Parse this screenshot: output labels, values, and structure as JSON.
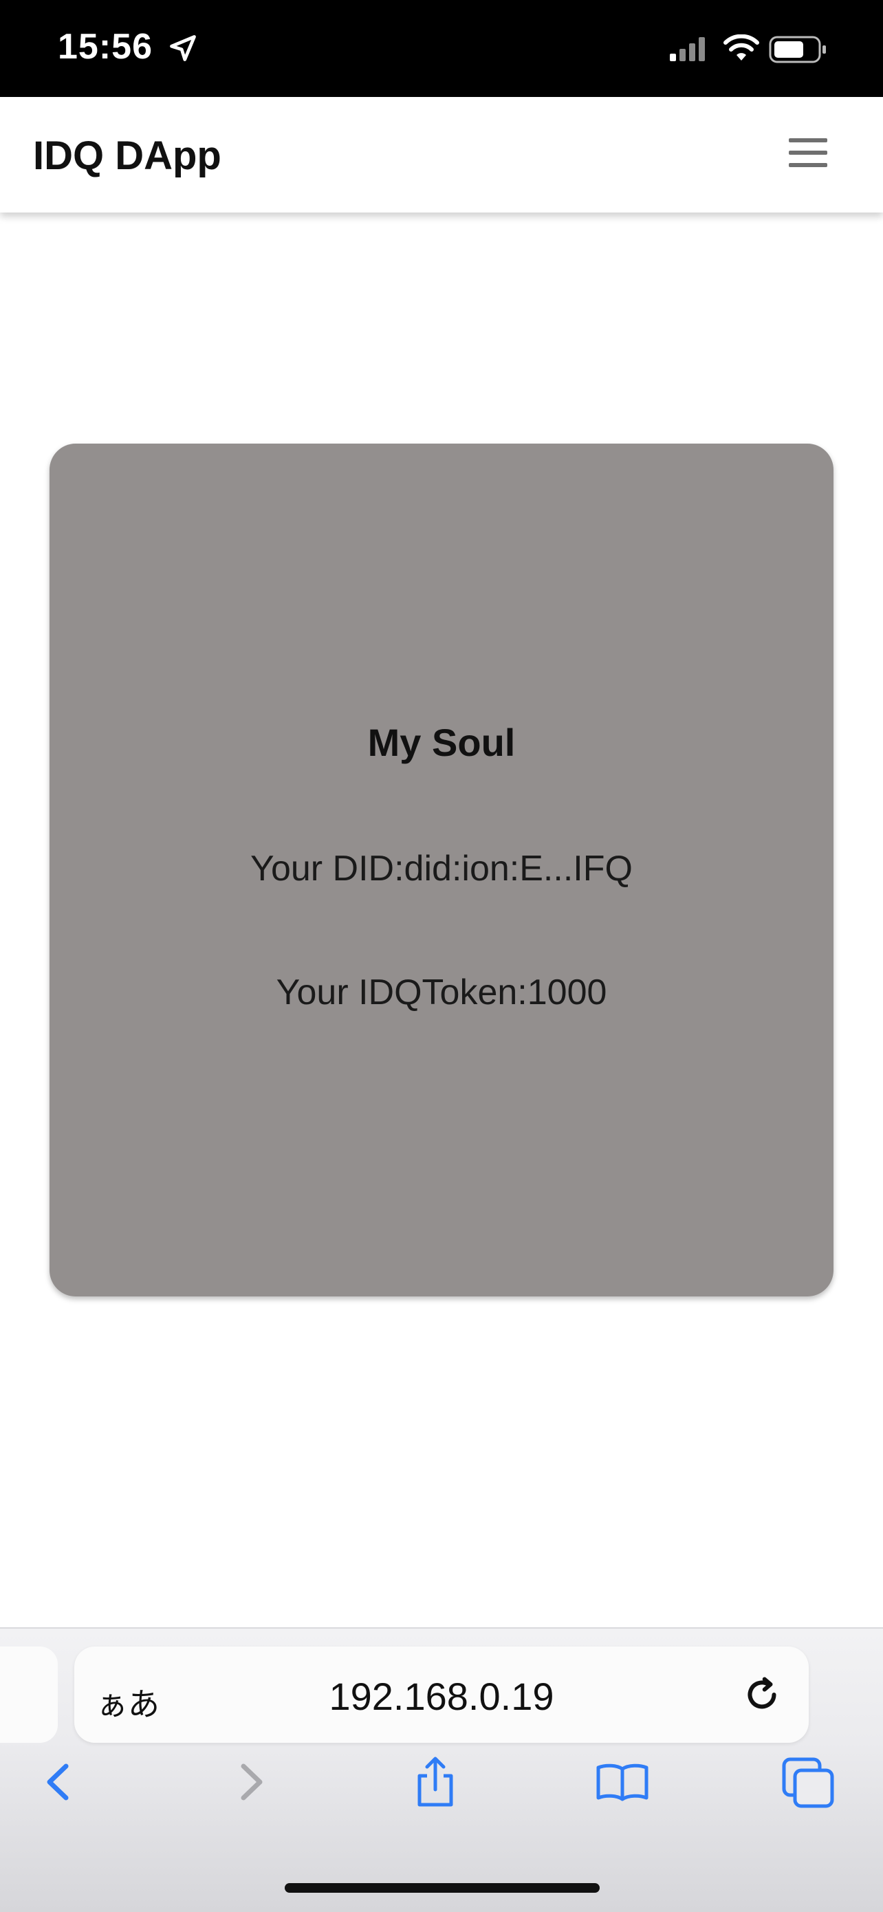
{
  "status_bar": {
    "time": "15:56",
    "icons": [
      "location-arrow-icon",
      "cellular-signal-icon",
      "wifi-icon",
      "battery-icon"
    ]
  },
  "navbar": {
    "brand": "IDQ DApp",
    "menu_icon": "hamburger-menu-icon"
  },
  "card": {
    "title": "My Soul",
    "did": "Your DID:did:ion:E...IFQ",
    "token": "Your IDQToken:1000",
    "background": "#938f8e"
  },
  "browser": {
    "text_size_label": "ぁあ",
    "url": "192.168.0.19",
    "toolbar_icons": [
      "back-chevron-icon",
      "forward-chevron-icon",
      "share-icon",
      "bookmarks-icon",
      "tabs-icon"
    ],
    "accent": "#2f7cf6"
  }
}
